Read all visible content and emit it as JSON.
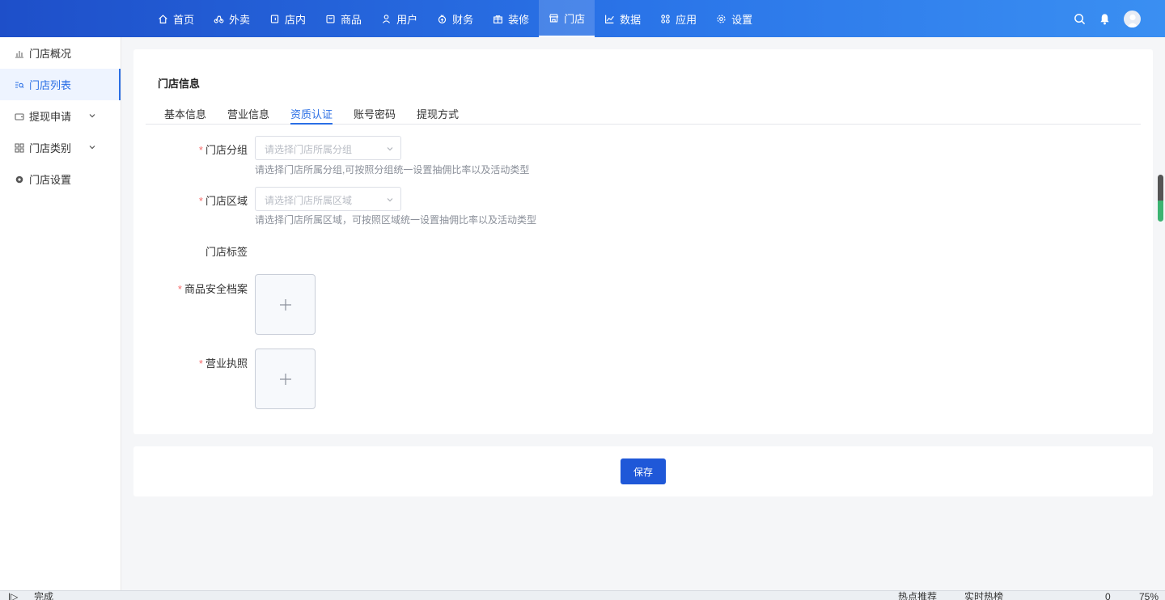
{
  "topnav": {
    "items": [
      {
        "label": "首页",
        "icon": "home-icon"
      },
      {
        "label": "外卖",
        "icon": "takeout-icon"
      },
      {
        "label": "店内",
        "icon": "dinein-icon"
      },
      {
        "label": "商品",
        "icon": "goods-icon"
      },
      {
        "label": "用户",
        "icon": "user-icon"
      },
      {
        "label": "财务",
        "icon": "finance-icon"
      },
      {
        "label": "装修",
        "icon": "decorate-icon"
      },
      {
        "label": "门店",
        "icon": "store-icon",
        "active": true
      },
      {
        "label": "数据",
        "icon": "chart-icon"
      },
      {
        "label": "应用",
        "icon": "apps-icon"
      },
      {
        "label": "设置",
        "icon": "gear-icon"
      }
    ]
  },
  "sidebar": {
    "items": [
      {
        "label": "门店概况",
        "icon": "bar-chart-icon"
      },
      {
        "label": "门店列表",
        "icon": "list-search-icon",
        "active": true
      },
      {
        "label": "提现申请",
        "icon": "wallet-icon",
        "expandable": true
      },
      {
        "label": "门店类别",
        "icon": "grid-icon",
        "expandable": true
      },
      {
        "label": "门店设置",
        "icon": "gear-icon"
      }
    ]
  },
  "card": {
    "title": "门店信息",
    "tabs": [
      "基本信息",
      "营业信息",
      "资质认证",
      "账号密码",
      "提现方式"
    ],
    "active_tab": "资质认证"
  },
  "form": {
    "group": {
      "label": "门店分组",
      "placeholder": "请选择门店所属分组",
      "hint": "请选择门店所属分组,可按照分组统一设置抽佣比率以及活动类型"
    },
    "region": {
      "label": "门店区域",
      "placeholder": "请选择门店所属区域",
      "hint": "请选择门店所属区域，可按照区域统一设置抽佣比率以及活动类型"
    },
    "tags": {
      "label": "门店标签"
    },
    "safety": {
      "label": "商品安全档案"
    },
    "license": {
      "label": "营业执照"
    },
    "required_mark": "*"
  },
  "footer": {
    "save_label": "保存"
  },
  "statusbar": {
    "status": "完成",
    "hot_recommend": "热点推荐",
    "realtime_hot": "实时热榜",
    "count": "0",
    "zoom": "75%"
  },
  "colors": {
    "accent": "#2b6fe5",
    "nav_start": "#1e4fc9",
    "nav_end": "#3a8ff2",
    "required": "#f56c6c",
    "save_button": "#1f58d8"
  }
}
